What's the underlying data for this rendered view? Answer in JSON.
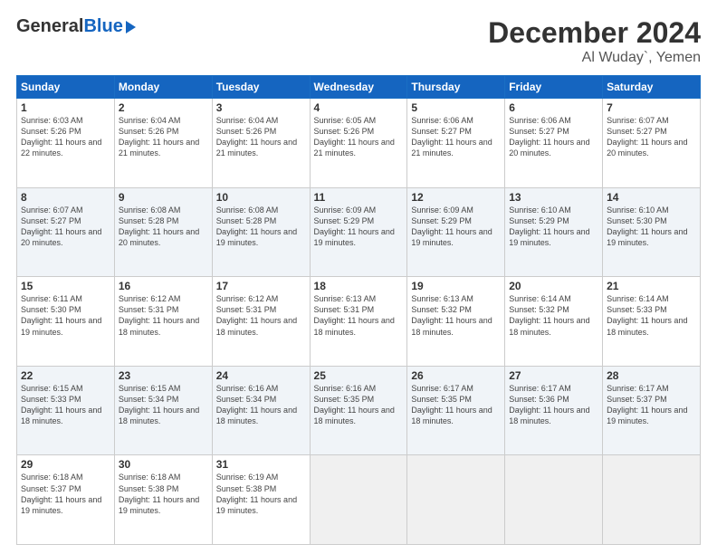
{
  "header": {
    "logo_line1": "General",
    "logo_line2": "Blue",
    "title": "December 2024",
    "subtitle": "Al Wuday`, Yemen"
  },
  "weekdays": [
    "Sunday",
    "Monday",
    "Tuesday",
    "Wednesday",
    "Thursday",
    "Friday",
    "Saturday"
  ],
  "weeks": [
    [
      {
        "day": 1,
        "sunrise": "6:03 AM",
        "sunset": "5:26 PM",
        "daylight": "11 hours and 22 minutes."
      },
      {
        "day": 2,
        "sunrise": "6:04 AM",
        "sunset": "5:26 PM",
        "daylight": "11 hours and 21 minutes."
      },
      {
        "day": 3,
        "sunrise": "6:04 AM",
        "sunset": "5:26 PM",
        "daylight": "11 hours and 21 minutes."
      },
      {
        "day": 4,
        "sunrise": "6:05 AM",
        "sunset": "5:26 PM",
        "daylight": "11 hours and 21 minutes."
      },
      {
        "day": 5,
        "sunrise": "6:06 AM",
        "sunset": "5:27 PM",
        "daylight": "11 hours and 21 minutes."
      },
      {
        "day": 6,
        "sunrise": "6:06 AM",
        "sunset": "5:27 PM",
        "daylight": "11 hours and 20 minutes."
      },
      {
        "day": 7,
        "sunrise": "6:07 AM",
        "sunset": "5:27 PM",
        "daylight": "11 hours and 20 minutes."
      }
    ],
    [
      {
        "day": 8,
        "sunrise": "6:07 AM",
        "sunset": "5:27 PM",
        "daylight": "11 hours and 20 minutes."
      },
      {
        "day": 9,
        "sunrise": "6:08 AM",
        "sunset": "5:28 PM",
        "daylight": "11 hours and 20 minutes."
      },
      {
        "day": 10,
        "sunrise": "6:08 AM",
        "sunset": "5:28 PM",
        "daylight": "11 hours and 19 minutes."
      },
      {
        "day": 11,
        "sunrise": "6:09 AM",
        "sunset": "5:29 PM",
        "daylight": "11 hours and 19 minutes."
      },
      {
        "day": 12,
        "sunrise": "6:09 AM",
        "sunset": "5:29 PM",
        "daylight": "11 hours and 19 minutes."
      },
      {
        "day": 13,
        "sunrise": "6:10 AM",
        "sunset": "5:29 PM",
        "daylight": "11 hours and 19 minutes."
      },
      {
        "day": 14,
        "sunrise": "6:10 AM",
        "sunset": "5:30 PM",
        "daylight": "11 hours and 19 minutes."
      }
    ],
    [
      {
        "day": 15,
        "sunrise": "6:11 AM",
        "sunset": "5:30 PM",
        "daylight": "11 hours and 19 minutes."
      },
      {
        "day": 16,
        "sunrise": "6:12 AM",
        "sunset": "5:31 PM",
        "daylight": "11 hours and 18 minutes."
      },
      {
        "day": 17,
        "sunrise": "6:12 AM",
        "sunset": "5:31 PM",
        "daylight": "11 hours and 18 minutes."
      },
      {
        "day": 18,
        "sunrise": "6:13 AM",
        "sunset": "5:31 PM",
        "daylight": "11 hours and 18 minutes."
      },
      {
        "day": 19,
        "sunrise": "6:13 AM",
        "sunset": "5:32 PM",
        "daylight": "11 hours and 18 minutes."
      },
      {
        "day": 20,
        "sunrise": "6:14 AM",
        "sunset": "5:32 PM",
        "daylight": "11 hours and 18 minutes."
      },
      {
        "day": 21,
        "sunrise": "6:14 AM",
        "sunset": "5:33 PM",
        "daylight": "11 hours and 18 minutes."
      }
    ],
    [
      {
        "day": 22,
        "sunrise": "6:15 AM",
        "sunset": "5:33 PM",
        "daylight": "11 hours and 18 minutes."
      },
      {
        "day": 23,
        "sunrise": "6:15 AM",
        "sunset": "5:34 PM",
        "daylight": "11 hours and 18 minutes."
      },
      {
        "day": 24,
        "sunrise": "6:16 AM",
        "sunset": "5:34 PM",
        "daylight": "11 hours and 18 minutes."
      },
      {
        "day": 25,
        "sunrise": "6:16 AM",
        "sunset": "5:35 PM",
        "daylight": "11 hours and 18 minutes."
      },
      {
        "day": 26,
        "sunrise": "6:17 AM",
        "sunset": "5:35 PM",
        "daylight": "11 hours and 18 minutes."
      },
      {
        "day": 27,
        "sunrise": "6:17 AM",
        "sunset": "5:36 PM",
        "daylight": "11 hours and 18 minutes."
      },
      {
        "day": 28,
        "sunrise": "6:17 AM",
        "sunset": "5:37 PM",
        "daylight": "11 hours and 19 minutes."
      }
    ],
    [
      {
        "day": 29,
        "sunrise": "6:18 AM",
        "sunset": "5:37 PM",
        "daylight": "11 hours and 19 minutes."
      },
      {
        "day": 30,
        "sunrise": "6:18 AM",
        "sunset": "5:38 PM",
        "daylight": "11 hours and 19 minutes."
      },
      {
        "day": 31,
        "sunrise": "6:19 AM",
        "sunset": "5:38 PM",
        "daylight": "11 hours and 19 minutes."
      },
      null,
      null,
      null,
      null
    ]
  ]
}
